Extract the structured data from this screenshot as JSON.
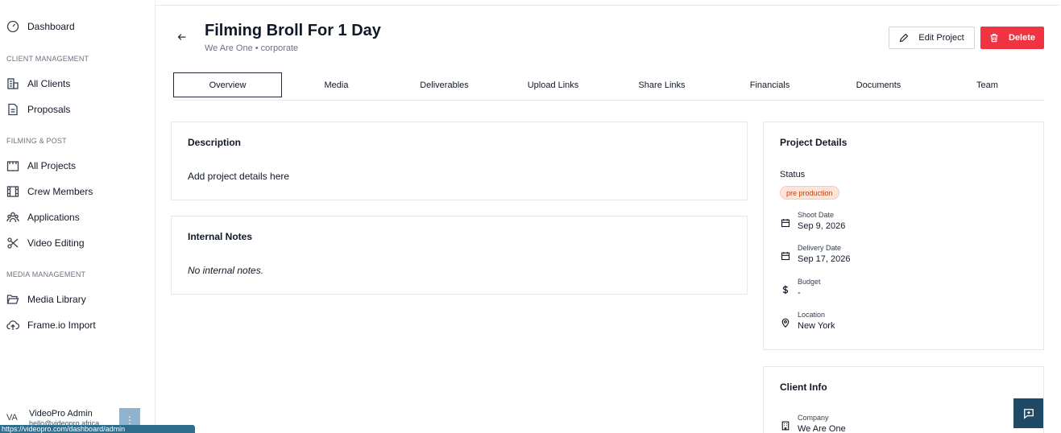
{
  "sidebar": {
    "dashboard": "Dashboard",
    "sections": [
      {
        "label": "CLIENT MANAGEMENT",
        "items": [
          "All Clients",
          "Proposals"
        ]
      },
      {
        "label": "FILMING & POST",
        "items": [
          "All Projects",
          "Crew Members",
          "Applications",
          "Video Editing"
        ]
      },
      {
        "label": "MEDIA MANAGEMENT",
        "items": [
          "Media Library",
          "Frame.io Import"
        ]
      }
    ],
    "user": {
      "initials": "VA",
      "name": "VideoPro Admin",
      "email": "hello@videopro.africa",
      "menu_glyph": "⋮"
    },
    "status_url": "https://videopro.com/dashboard/admin"
  },
  "header": {
    "title": "Filming Broll For 1 Day",
    "subtitle": "We Are One • corporate",
    "edit_label": "Edit Project",
    "delete_label": "Delete"
  },
  "tabs": [
    {
      "label": "Overview",
      "active": true
    },
    {
      "label": "Media",
      "active": false
    },
    {
      "label": "Deliverables",
      "active": false
    },
    {
      "label": "Upload Links",
      "active": false
    },
    {
      "label": "Share Links",
      "active": false
    },
    {
      "label": "Financials",
      "active": false
    },
    {
      "label": "Documents",
      "active": false
    },
    {
      "label": "Team",
      "active": false
    }
  ],
  "description": {
    "title": "Description",
    "body": "Add project details here"
  },
  "internal_notes": {
    "title": "Internal Notes",
    "body": "No internal notes."
  },
  "project_details": {
    "title": "Project Details",
    "status_label": "Status",
    "status_value": "pre production",
    "shoot_date_label": "Shoot Date",
    "shoot_date": "Sep 9, 2026",
    "delivery_date_label": "Delivery Date",
    "delivery_date": "Sep 17, 2026",
    "budget_label": "Budget",
    "budget": "-",
    "location_label": "Location",
    "location": "New York"
  },
  "client_info": {
    "title": "Client Info",
    "company_label": "Company",
    "company": "We Are One"
  },
  "colors": {
    "danger": "#ef3340",
    "badge_bg": "#fde4d8",
    "badge_text": "#c2410c",
    "chat_bg": "#1e4a66"
  }
}
